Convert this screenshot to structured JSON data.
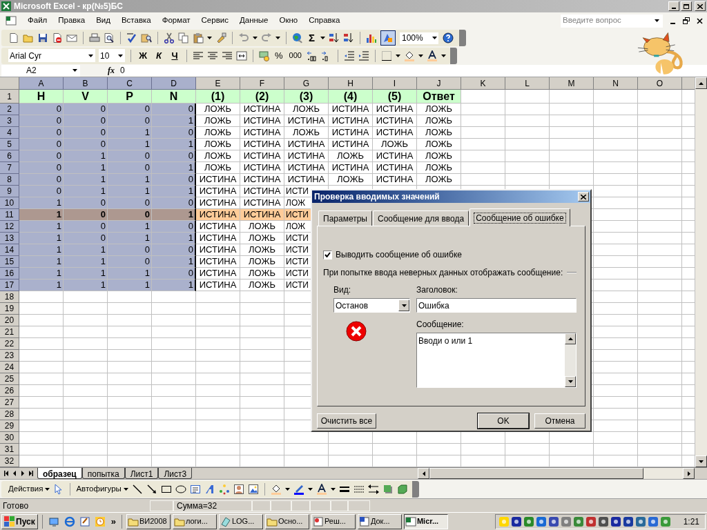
{
  "window": {
    "title": "Microsoft Excel - кр(№5)БС"
  },
  "menu": [
    "Файл",
    "Правка",
    "Вид",
    "Вставка",
    "Формат",
    "Сервис",
    "Данные",
    "Окно",
    "Справка"
  ],
  "help_box": {
    "placeholder": "Введите вопрос"
  },
  "standard_toolbar": {
    "sum": "Σ",
    "zoom": "100%"
  },
  "formatting_toolbar": {
    "font": "Arial Cyr",
    "size": "10",
    "bold": "Ж",
    "italic": "К",
    "underline": "Ч",
    "percent": "%",
    "thousands": "000"
  },
  "formula_bar": {
    "name_box": "A2",
    "fx": "fx",
    "value": "0"
  },
  "sheet": {
    "columns": [
      {
        "letter": "A",
        "selected": true
      },
      {
        "letter": "B",
        "selected": true
      },
      {
        "letter": "C",
        "selected": true
      },
      {
        "letter": "D",
        "selected": true
      },
      {
        "letter": "E",
        "selected": false
      },
      {
        "letter": "F",
        "selected": false
      },
      {
        "letter": "G",
        "selected": false
      },
      {
        "letter": "H",
        "selected": false
      },
      {
        "letter": "I",
        "selected": false
      },
      {
        "letter": "J",
        "selected": false
      },
      {
        "letter": "K",
        "selected": false
      },
      {
        "letter": "L",
        "selected": false
      },
      {
        "letter": "M",
        "selected": false
      },
      {
        "letter": "N",
        "selected": false
      },
      {
        "letter": "O",
        "selected": false
      }
    ],
    "rows": [
      {
        "number": "1",
        "kind": "header",
        "selected": false,
        "highlighted": false,
        "cells": [
          "H",
          "V",
          "P",
          "N",
          "(1)",
          "(2)",
          "(3)",
          "(4)",
          "(5)",
          "Ответ"
        ]
      },
      {
        "number": "2",
        "kind": "data",
        "selected": true,
        "highlighted": false,
        "cells": [
          "0",
          "0",
          "0",
          "0",
          "ЛОЖЬ",
          "ИСТИНА",
          "ЛОЖЬ",
          "ИСТИНА",
          "ИСТИНА",
          "ЛОЖЬ"
        ]
      },
      {
        "number": "3",
        "kind": "data",
        "selected": true,
        "highlighted": false,
        "cells": [
          "0",
          "0",
          "0",
          "1",
          "ЛОЖЬ",
          "ИСТИНА",
          "ИСТИНА",
          "ИСТИНА",
          "ИСТИНА",
          "ЛОЖЬ"
        ]
      },
      {
        "number": "4",
        "kind": "data",
        "selected": true,
        "highlighted": false,
        "cells": [
          "0",
          "0",
          "1",
          "0",
          "ЛОЖЬ",
          "ИСТИНА",
          "ЛОЖЬ",
          "ИСТИНА",
          "ИСТИНА",
          "ЛОЖЬ"
        ]
      },
      {
        "number": "5",
        "kind": "data",
        "selected": true,
        "highlighted": false,
        "cells": [
          "0",
          "0",
          "1",
          "1",
          "ЛОЖЬ",
          "ИСТИНА",
          "ИСТИНА",
          "ИСТИНА",
          "ЛОЖЬ",
          "ЛОЖЬ"
        ]
      },
      {
        "number": "6",
        "kind": "data",
        "selected": true,
        "highlighted": false,
        "cells": [
          "0",
          "1",
          "0",
          "0",
          "ЛОЖЬ",
          "ИСТИНА",
          "ИСТИНА",
          "ЛОЖЬ",
          "ИСТИНА",
          "ЛОЖЬ"
        ]
      },
      {
        "number": "7",
        "kind": "data",
        "selected": true,
        "highlighted": false,
        "cells": [
          "0",
          "1",
          "0",
          "1",
          "ЛОЖЬ",
          "ИСТИНА",
          "ИСТИНА",
          "ИСТИНА",
          "ИСТИНА",
          "ЛОЖЬ"
        ]
      },
      {
        "number": "8",
        "kind": "data",
        "selected": true,
        "highlighted": false,
        "cells": [
          "0",
          "1",
          "1",
          "0",
          "ИСТИНА",
          "ИСТИНА",
          "ИСТИНА",
          "ЛОЖЬ",
          "ИСТИНА",
          "ЛОЖЬ"
        ]
      },
      {
        "number": "9",
        "kind": "data",
        "selected": true,
        "highlighted": false,
        "cells": [
          "0",
          "1",
          "1",
          "1",
          "ИСТИНА",
          "ИСТИНА",
          "ИСТИ"
        ]
      },
      {
        "number": "10",
        "kind": "data",
        "selected": true,
        "highlighted": false,
        "cells": [
          "1",
          "0",
          "0",
          "0",
          "ИСТИНА",
          "ИСТИНА",
          "ЛОЖ"
        ]
      },
      {
        "number": "11",
        "kind": "data",
        "selected": true,
        "highlighted": true,
        "cells": [
          "1",
          "0",
          "0",
          "1",
          "ИСТИНА",
          "ИСТИНА",
          "ИСТИ"
        ]
      },
      {
        "number": "12",
        "kind": "data",
        "selected": true,
        "highlighted": false,
        "cells": [
          "1",
          "0",
          "1",
          "0",
          "ИСТИНА",
          "ЛОЖЬ",
          "ЛОЖ"
        ]
      },
      {
        "number": "13",
        "kind": "data",
        "selected": true,
        "highlighted": false,
        "cells": [
          "1",
          "0",
          "1",
          "1",
          "ИСТИНА",
          "ЛОЖЬ",
          "ИСТИ"
        ]
      },
      {
        "number": "14",
        "kind": "data",
        "selected": true,
        "highlighted": false,
        "cells": [
          "1",
          "1",
          "0",
          "0",
          "ИСТИНА",
          "ЛОЖЬ",
          "ИСТИ"
        ]
      },
      {
        "number": "15",
        "kind": "data",
        "selected": true,
        "highlighted": false,
        "cells": [
          "1",
          "1",
          "0",
          "1",
          "ИСТИНА",
          "ЛОЖЬ",
          "ИСТИ"
        ]
      },
      {
        "number": "16",
        "kind": "data",
        "selected": true,
        "highlighted": false,
        "cells": [
          "1",
          "1",
          "1",
          "0",
          "ИСТИНА",
          "ЛОЖЬ",
          "ИСТИ"
        ]
      },
      {
        "number": "17",
        "kind": "data",
        "selected": true,
        "highlighted": false,
        "cells": [
          "1",
          "1",
          "1",
          "1",
          "ИСТИНА",
          "ЛОЖЬ",
          "ИСТИ"
        ]
      },
      {
        "number": "18",
        "kind": "data",
        "selected": false,
        "highlighted": false
      },
      {
        "number": "19",
        "kind": "data",
        "selected": false,
        "highlighted": false
      },
      {
        "number": "20",
        "kind": "data",
        "selected": false,
        "highlighted": false
      },
      {
        "number": "21",
        "kind": "data",
        "selected": false,
        "highlighted": false
      },
      {
        "number": "22",
        "kind": "data",
        "selected": false,
        "highlighted": false
      },
      {
        "number": "23",
        "kind": "data",
        "selected": false,
        "highlighted": false
      },
      {
        "number": "24",
        "kind": "data",
        "selected": false,
        "highlighted": false
      },
      {
        "number": "25",
        "kind": "data",
        "selected": false,
        "highlighted": false
      },
      {
        "number": "26",
        "kind": "data",
        "selected": false,
        "highlighted": false
      },
      {
        "number": "27",
        "kind": "data",
        "selected": false,
        "highlighted": false
      },
      {
        "number": "28",
        "kind": "data",
        "selected": false,
        "highlighted": false
      },
      {
        "number": "29",
        "kind": "data",
        "selected": false,
        "highlighted": false
      },
      {
        "number": "30",
        "kind": "data",
        "selected": false,
        "highlighted": false
      },
      {
        "number": "31",
        "kind": "data",
        "selected": false,
        "highlighted": false
      },
      {
        "number": "32",
        "kind": "data",
        "selected": false,
        "highlighted": false
      }
    ]
  },
  "dialog": {
    "title": "Проверка вводимых значений",
    "tabs": [
      {
        "label": "Параметры",
        "selected": false
      },
      {
        "label": "Сообщение для ввода",
        "selected": false
      },
      {
        "label": "Сообщение об ошибке",
        "selected": true
      }
    ],
    "show_error": {
      "label": "Выводить сообщение об ошибке",
      "checked": true
    },
    "group_label": "При попытке ввода неверных данных отображать сообщение:",
    "style": {
      "label": "Вид:",
      "value": "Останов"
    },
    "title_field": {
      "label": "Заголовок:",
      "value": "Ошибка"
    },
    "message": {
      "label": "Сообщение:",
      "value": "Вводи о или 1"
    },
    "buttons": [
      "Очистить все",
      "OK",
      "Отмена"
    ]
  },
  "sheet_tabs": [
    {
      "label": "образец",
      "selected": true
    },
    {
      "label": "попытка",
      "selected": false
    },
    {
      "label": "Лист1",
      "selected": false
    },
    {
      "label": "Лист3",
      "selected": false
    }
  ],
  "drawing_toolbar": {
    "actions": "Действия",
    "autoshapes": "Автофигуры"
  },
  "status_bar": {
    "status": "Готово",
    "sum": "Сумма=32"
  },
  "taskbar": {
    "start": "Пуск",
    "more": "»",
    "tasks": [
      {
        "label": "ВИ2008",
        "selected": false
      },
      {
        "label": "логи...",
        "selected": false
      },
      {
        "label": "LOG...",
        "selected": false
      },
      {
        "label": "Осно...",
        "selected": false
      },
      {
        "label": "Реш...",
        "selected": false
      },
      {
        "label": "Док...",
        "selected": false
      },
      {
        "label": "Micr...",
        "selected": true
      }
    ],
    "clock": "1:21"
  }
}
